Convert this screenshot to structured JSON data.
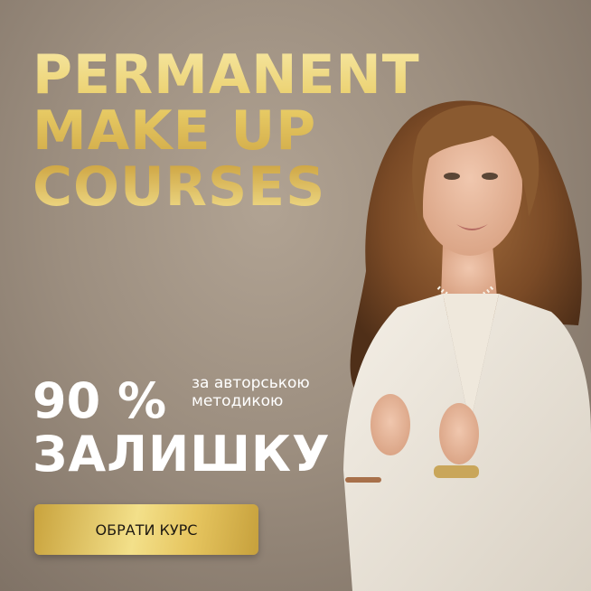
{
  "headline": {
    "line1": "PERMANENT",
    "line2": "MAKE UP",
    "line3": "COURSES"
  },
  "promo": {
    "percent": "90 %",
    "method_line1": "за авторською",
    "method_line2": "методикою",
    "discount": "ЗАЛИШКУ"
  },
  "cta": {
    "label": "ОБРАТИ КУРС"
  },
  "colors": {
    "background": "#9c8e7f",
    "gold": "#e9cd67",
    "text": "#ffffff"
  }
}
